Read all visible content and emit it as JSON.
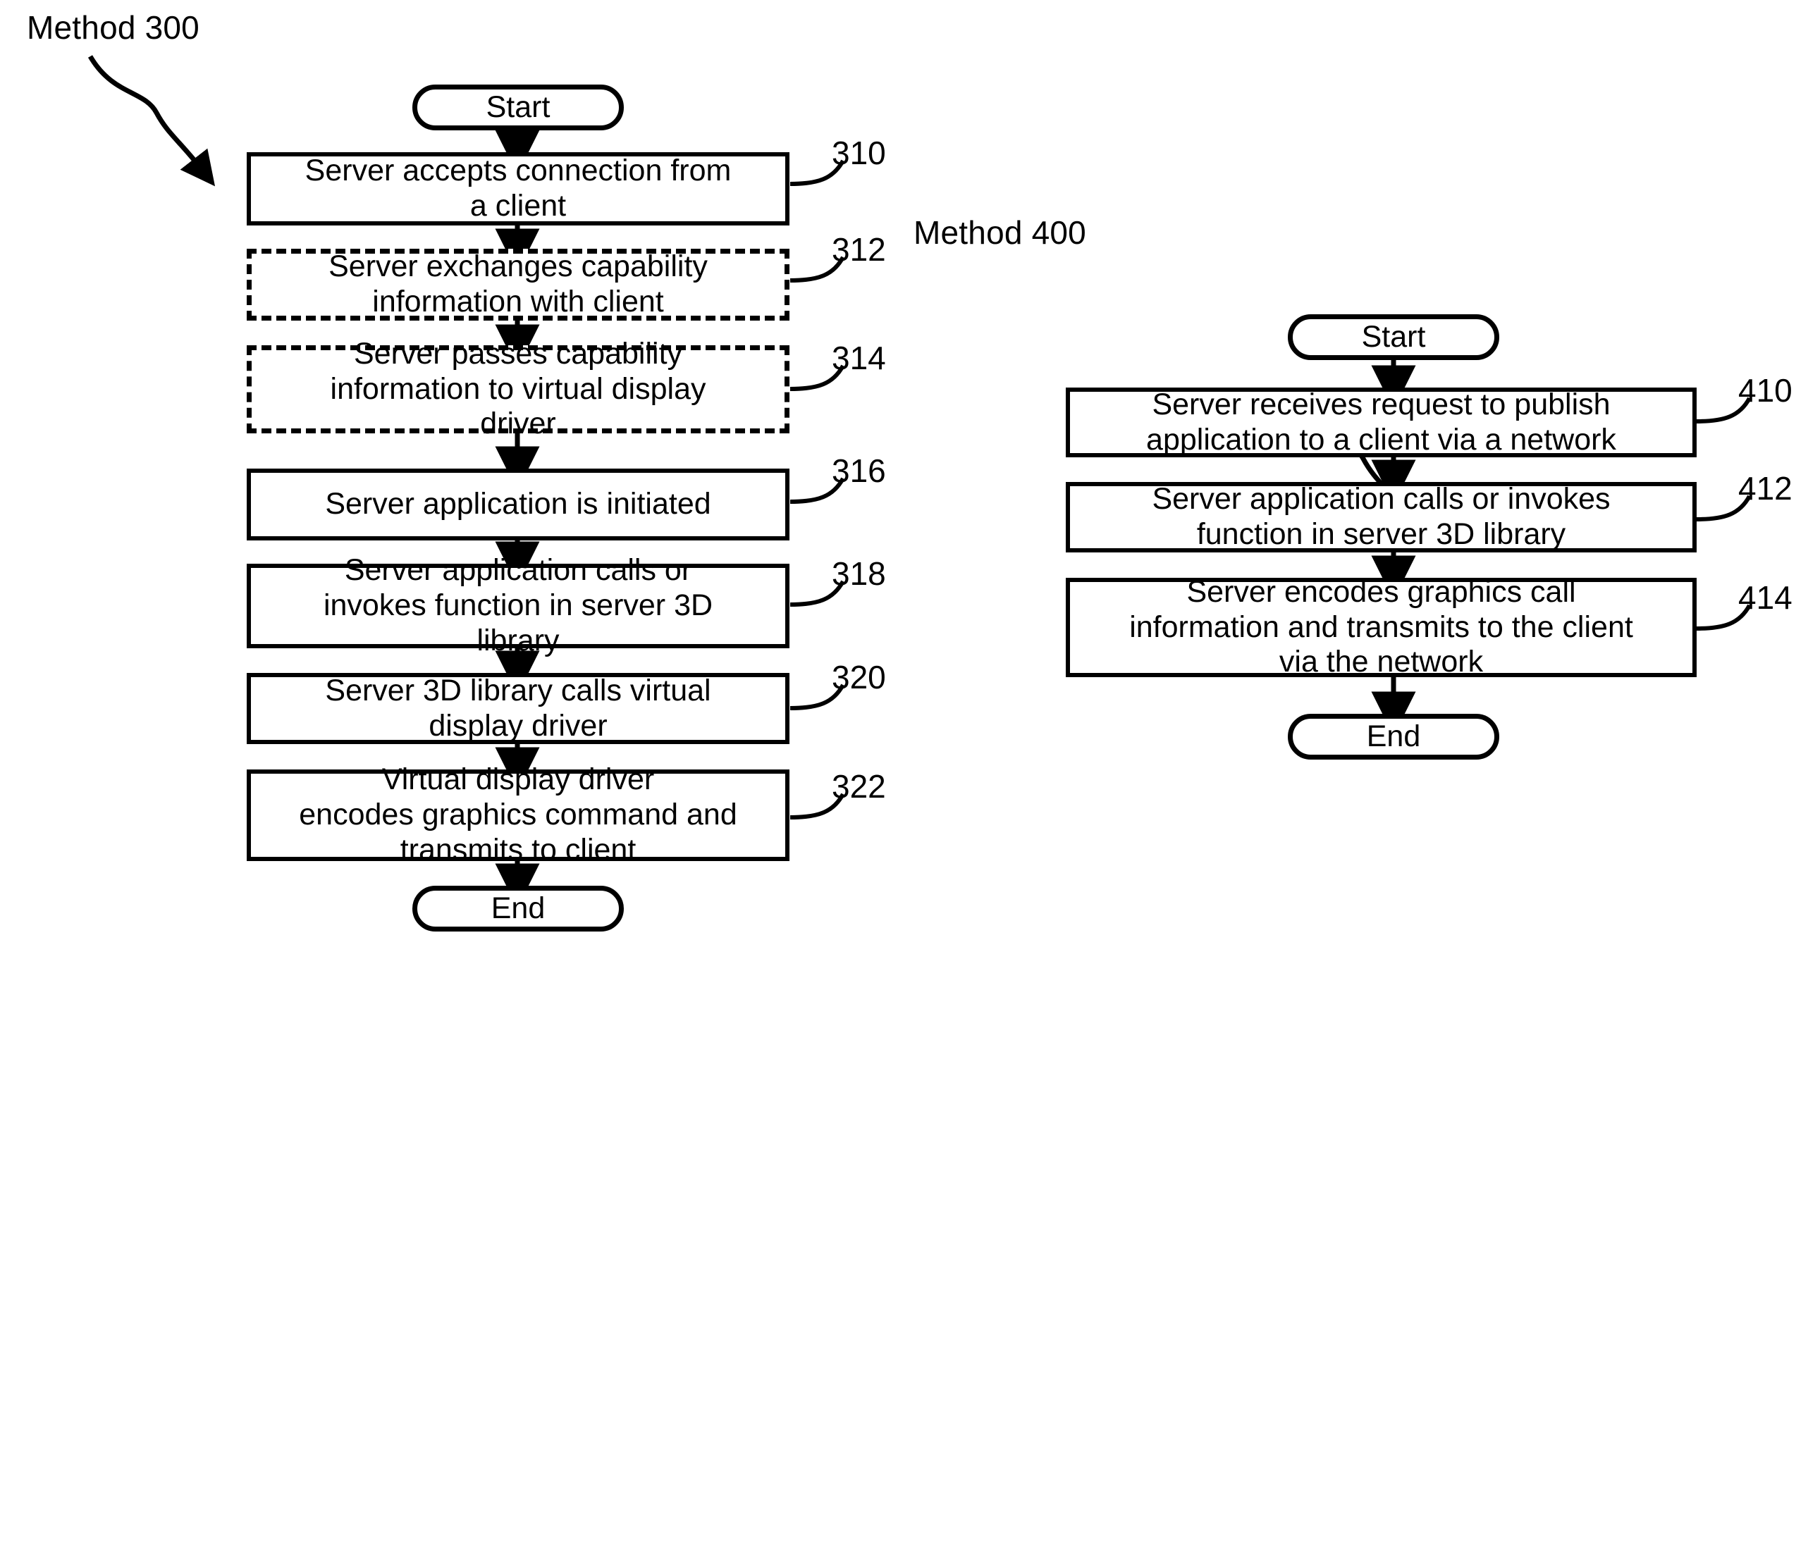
{
  "figure": {
    "type": "flowchart",
    "orientation": "two-column",
    "background": "#ffffff",
    "ink": "#000000"
  },
  "methods": [
    {
      "id": "method-300",
      "caption": "Method 300",
      "nodes": [
        {
          "ref": "",
          "shape": "terminal",
          "text": "Start"
        },
        {
          "ref": "310",
          "shape": "process",
          "text": "Server accepts connection from a client"
        },
        {
          "ref": "312",
          "shape": "optional",
          "text": "Server exchanges capability information with client"
        },
        {
          "ref": "314",
          "shape": "optional",
          "text": "Server passes capability information to virtual display driver"
        },
        {
          "ref": "316",
          "shape": "process",
          "text": "Server application is initiated"
        },
        {
          "ref": "318",
          "shape": "process",
          "text": "Server application calls or invokes function in server 3D library"
        },
        {
          "ref": "320",
          "shape": "process",
          "text": "Server 3D library calls virtual display driver"
        },
        {
          "ref": "322",
          "shape": "process",
          "text": "Virtual display driver encodes graphics command and transmits to client"
        },
        {
          "ref": "",
          "shape": "terminal",
          "text": "End"
        }
      ]
    },
    {
      "id": "method-400",
      "caption": "Method 400",
      "nodes": [
        {
          "ref": "",
          "shape": "terminal",
          "text": "Start"
        },
        {
          "ref": "410",
          "shape": "process",
          "text": "Server receives request to publish application to a client via a network"
        },
        {
          "ref": "412",
          "shape": "process",
          "text": "Server application calls or invokes function in server 3D library"
        },
        {
          "ref": "414",
          "shape": "process",
          "text": "Server encodes graphics call information and transmits to the client via the network"
        },
        {
          "ref": "",
          "shape": "terminal",
          "text": "End"
        }
      ]
    }
  ],
  "m300": {
    "caption": "Method 300",
    "start": "Start",
    "n310": "Server accepts connection from\na client",
    "n312": "Server exchanges capability\ninformation with client",
    "n314": "Server passes capability\ninformation to virtual display\ndriver",
    "n316": "Server application is initiated",
    "n318": "Server application calls or\ninvokes function in server 3D\nlibrary",
    "n320": "Server 3D library calls virtual\ndisplay driver",
    "n322": "Virtual display driver\nencodes graphics command and\ntransmits to client",
    "end": "End",
    "r310": "310",
    "r312": "312",
    "r314": "314",
    "r316": "316",
    "r318": "318",
    "r320": "320",
    "r322": "322"
  },
  "m400": {
    "caption": "Method 400",
    "start": "Start",
    "n410": "Server receives request to publish\napplication to a client via a network",
    "n412": "Server application calls or invokes\nfunction in server 3D library",
    "n414": "Server encodes graphics call\ninformation and transmits to the client\nvia the network",
    "end": "End",
    "r410": "410",
    "r412": "412",
    "r414": "414"
  }
}
